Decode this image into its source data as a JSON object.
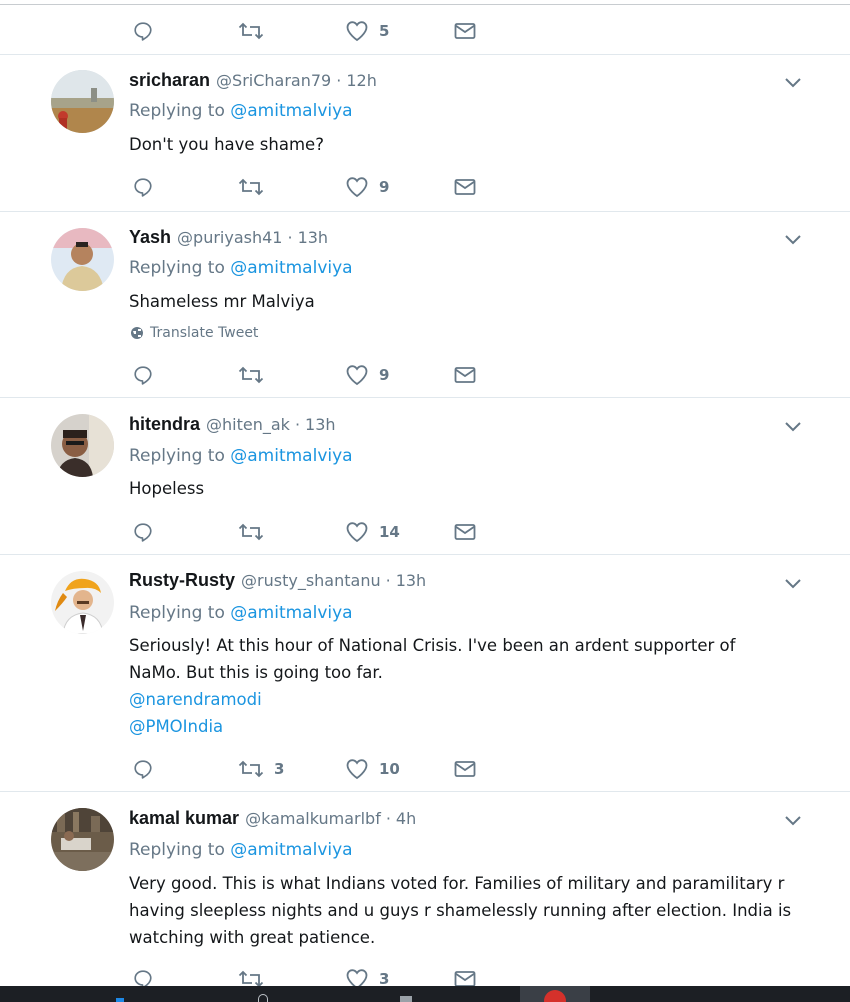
{
  "top_tweet": {
    "actions": {
      "reply_count": "",
      "retweet_count": "",
      "like_count": "5"
    }
  },
  "tweets": [
    {
      "name": "sricharan",
      "handle": "@SriCharan79",
      "separator": "·",
      "time": "12h",
      "replying_prefix": "Replying to ",
      "replying_to": "@amitmalviya",
      "text_lines": [
        "Don't you have shame?"
      ],
      "mentions": [],
      "translate": "",
      "actions": {
        "reply_count": "",
        "retweet_count": "",
        "like_count": "9"
      },
      "avatar_icon": "landscape-photo-avatar"
    },
    {
      "name": "Yash",
      "handle": "@puriyash41",
      "separator": "·",
      "time": "13h",
      "replying_prefix": "Replying to ",
      "replying_to": "@amitmalviya",
      "text_lines": [
        "Shameless mr Malviya"
      ],
      "mentions": [],
      "translate": "Translate Tweet",
      "actions": {
        "reply_count": "",
        "retweet_count": "",
        "like_count": "9"
      },
      "avatar_icon": "person-photo-avatar"
    },
    {
      "name": "hitendra",
      "handle": "@hiten_ak",
      "separator": "·",
      "time": "13h",
      "replying_prefix": "Replying to ",
      "replying_to": "@amitmalviya",
      "text_lines": [
        "Hopeless"
      ],
      "mentions": [],
      "translate": "",
      "actions": {
        "reply_count": "",
        "retweet_count": "",
        "like_count": "14"
      },
      "avatar_icon": "person-photo-avatar"
    },
    {
      "name": "Rusty-Rusty",
      "handle": "@rusty_shantanu",
      "separator": "·",
      "time": "13h",
      "replying_prefix": "Replying to ",
      "replying_to": "@amitmalviya",
      "text_lines": [
        "Seriously!  At this hour of National Crisis.  I've been an ardent supporter of",
        "NaMo. But this is going too far."
      ],
      "mentions": [
        "@narendramodi",
        "@PMOIndia"
      ],
      "translate": "",
      "actions": {
        "reply_count": "",
        "retweet_count": "3",
        "like_count": "10"
      },
      "avatar_icon": "illustrated-person-avatar"
    },
    {
      "name": "kamal kumar",
      "handle": "@kamalkumarlbf",
      "separator": "·",
      "time": "4h",
      "replying_prefix": "Replying to ",
      "replying_to": "@amitmalviya",
      "text_lines": [
        "Very good. This is what Indians voted for. Families of military and paramilitary r",
        "having sleepless nights and u guys r shamelessly running after election. India is",
        "watching with great patience."
      ],
      "mentions": [],
      "translate": "",
      "actions": {
        "reply_count": "",
        "retweet_count": "",
        "like_count": "3"
      },
      "avatar_icon": "outdoor-photo-avatar"
    }
  ],
  "colors": {
    "link": "#1b95e0",
    "secondary_text": "#657786",
    "divider": "#e1e8ed",
    "taskbar": "#1c1f24"
  }
}
